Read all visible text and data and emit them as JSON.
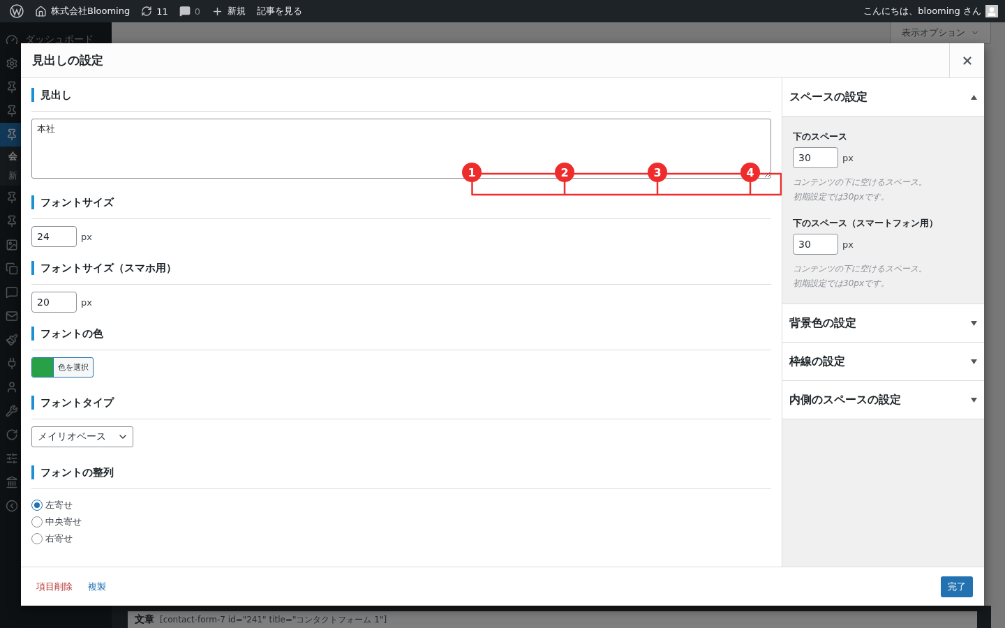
{
  "admin_bar": {
    "site": "株式会社Blooming",
    "updates": "11",
    "comments": "0",
    "new": "新規",
    "view": "記事を見る",
    "greeting": "こんにちは、blooming さん"
  },
  "sidebar": {
    "items": [
      {
        "kind": "dashboard",
        "label": "ダッシュボード",
        "selected": false
      },
      {
        "kind": "settings",
        "selected": false
      },
      {
        "kind": "pin",
        "selected": false
      },
      {
        "kind": "pin",
        "selected": false
      },
      {
        "kind": "pin",
        "selected": true
      },
      {
        "kind": "submenu",
        "label": "会",
        "selected": true
      },
      {
        "kind": "submenu",
        "label": "新",
        "selected": false
      },
      {
        "kind": "pin",
        "selected": false
      },
      {
        "kind": "pin",
        "selected": false
      },
      {
        "kind": "media",
        "selected": false
      },
      {
        "kind": "pages",
        "selected": false
      },
      {
        "kind": "comments",
        "selected": false
      },
      {
        "kind": "mail",
        "selected": false
      },
      {
        "kind": "brush",
        "selected": false
      },
      {
        "kind": "plug",
        "selected": false
      },
      {
        "kind": "user",
        "selected": false
      },
      {
        "kind": "tools",
        "selected": false
      },
      {
        "kind": "refresh",
        "selected": false
      },
      {
        "kind": "sliders",
        "selected": false
      },
      {
        "kind": "building",
        "selected": false
      },
      {
        "kind": "collapse",
        "selected": false
      }
    ]
  },
  "page": {
    "screen_options": "表示オプション",
    "block_label": "文章",
    "block_text": "[contact-form-7 id=\"241\" title=\"コンタクトフォーム 1\"]"
  },
  "modal": {
    "title": "見出しの設定",
    "sections": [
      {
        "kind": "textarea",
        "heading": "見出し",
        "value": "本社"
      },
      {
        "kind": "number",
        "heading": "フォントサイズ",
        "value": "24",
        "unit": "px"
      },
      {
        "kind": "number",
        "heading": "フォントサイズ（スマホ用）",
        "value": "20",
        "unit": "px"
      },
      {
        "kind": "color",
        "heading": "フォントの色",
        "color": "#28a046",
        "button": "色を選択"
      },
      {
        "kind": "select",
        "heading": "フォントタイプ",
        "value": "メイリオベース"
      },
      {
        "kind": "radio",
        "heading": "フォントの整列",
        "options": [
          {
            "label": "左寄せ",
            "selected": true
          },
          {
            "label": "中央寄せ",
            "selected": false
          },
          {
            "label": "右寄せ",
            "selected": false
          }
        ]
      }
    ],
    "side_panels": [
      {
        "title": "スペースの設定",
        "expanded": true,
        "fields": [
          {
            "label": "下のスペース",
            "value": "30",
            "unit": "px",
            "help": [
              "コンテンツの下に空けるスペース。",
              "初期設定では30pxです。"
            ]
          },
          {
            "label": "下のスペース（スマートフォン用）",
            "value": "30",
            "unit": "px",
            "help": [
              "コンテンツの下に空けるスペース。",
              "初期設定では30pxです。"
            ]
          }
        ]
      },
      {
        "title": "背景色の設定",
        "expanded": false
      },
      {
        "title": "枠線の設定",
        "expanded": false
      },
      {
        "title": "内側のスペースの設定",
        "expanded": false
      }
    ],
    "footer": {
      "delete": "項目削除",
      "duplicate": "複製",
      "done": "完了"
    },
    "annotation": {
      "markers": [
        "1",
        "2",
        "3",
        "4"
      ]
    }
  }
}
